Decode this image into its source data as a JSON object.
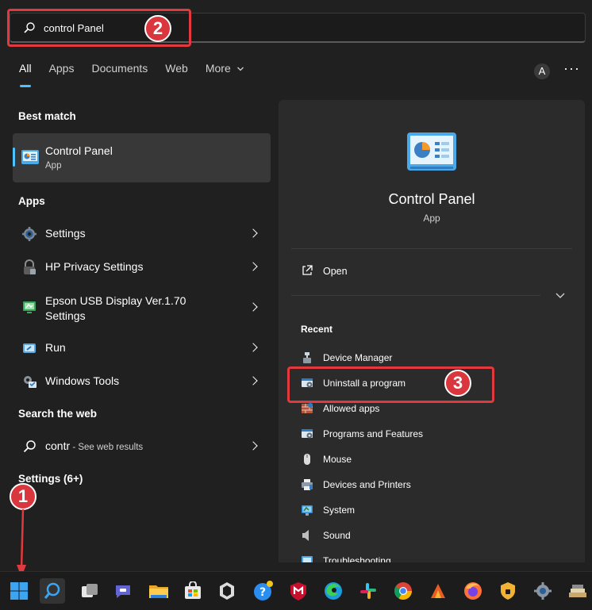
{
  "search": {
    "query": "control Panel"
  },
  "tabs": [
    {
      "label": "All"
    },
    {
      "label": "Apps"
    },
    {
      "label": "Documents"
    },
    {
      "label": "Web"
    },
    {
      "label": "More"
    }
  ],
  "header": {
    "avatar_letter": "A",
    "more_dots": "···"
  },
  "left": {
    "best_match_title": "Best match",
    "best_match": {
      "title": "Control Panel",
      "subtitle": "App"
    },
    "apps_title": "Apps",
    "apps": [
      {
        "label": "Settings",
        "icon": "gear-icon"
      },
      {
        "label": "HP Privacy Settings",
        "icon": "lock-icon"
      },
      {
        "label": "Epson USB Display Ver.1.70 Settings",
        "line1": "Epson USB Display Ver.1.70",
        "line2": "Settings",
        "icon": "epson-display-icon"
      },
      {
        "label": "Run",
        "icon": "run-icon"
      },
      {
        "label": "Windows Tools",
        "icon": "tools-icon"
      }
    ],
    "web_title": "Search the web",
    "web_result": {
      "query": "contr",
      "suffix": " - See web results"
    },
    "settings_title": "Settings (6+)"
  },
  "right": {
    "title": "Control Panel",
    "subtitle": "App",
    "open_label": "Open",
    "recent_title": "Recent",
    "recent": [
      {
        "label": "Device Manager",
        "icon": "device-manager-icon"
      },
      {
        "label": "Uninstall a program",
        "icon": "programs-icon"
      },
      {
        "label": "Allowed apps",
        "icon": "firewall-icon"
      },
      {
        "label": "Programs and Features",
        "icon": "programs-icon"
      },
      {
        "label": "Mouse",
        "icon": "mouse-icon"
      },
      {
        "label": "Devices and Printers",
        "icon": "printer-icon"
      },
      {
        "label": "System",
        "icon": "system-icon"
      },
      {
        "label": "Sound",
        "icon": "sound-icon"
      },
      {
        "label": "Troubleshooting",
        "icon": "troubleshoot-icon"
      }
    ]
  },
  "annotations": [
    {
      "number": "1"
    },
    {
      "number": "2"
    },
    {
      "number": "3"
    }
  ],
  "colors": {
    "accent": "#4cc2ff",
    "annotation": "#e03a3e",
    "panel": "#2b2b2b",
    "background": "#202020"
  },
  "taskbar": [
    "windows-start-icon",
    "search-icon",
    "task-view-icon",
    "teams-chat-icon",
    "file-explorer-icon",
    "store-icon",
    "hp-icon",
    "help-icon",
    "mcafee-icon",
    "edge-icon",
    "slack-icon",
    "chrome-icon",
    "app-icon",
    "firefox-icon",
    "vpn-icon",
    "settings-icon",
    "stack-icon"
  ]
}
